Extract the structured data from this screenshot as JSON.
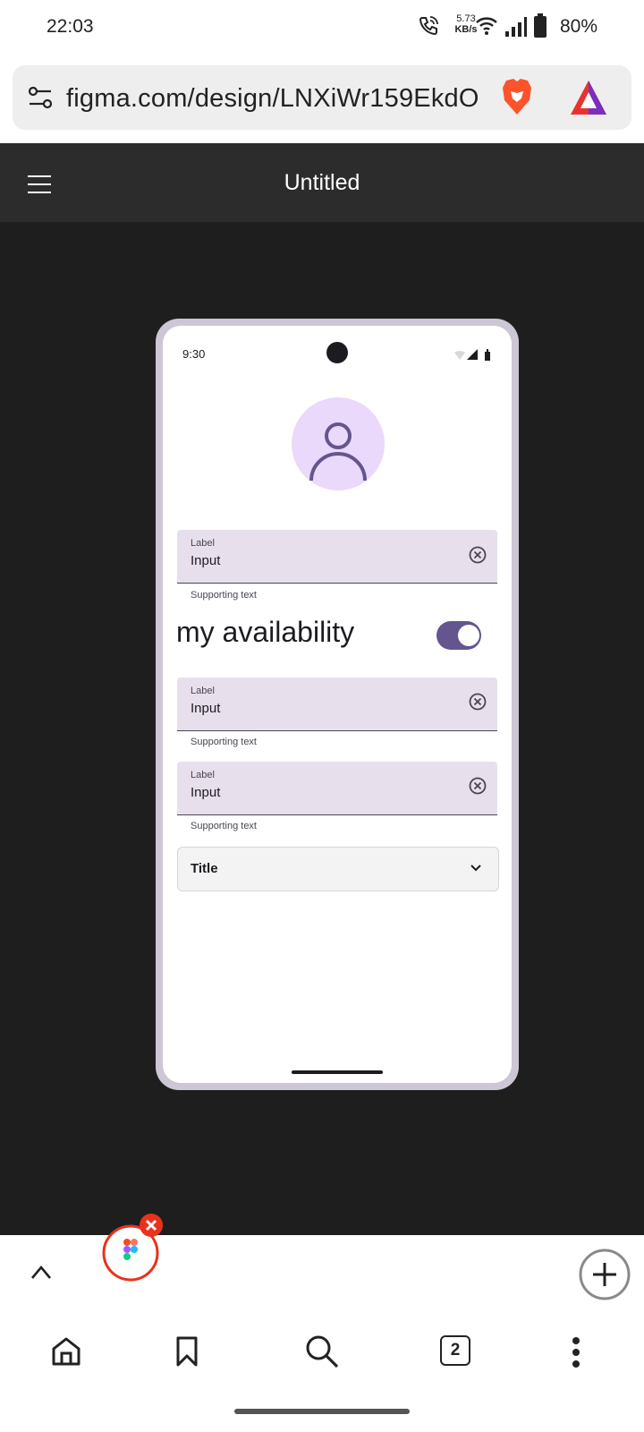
{
  "status_bar": {
    "time": "22:03",
    "net_speed_value": "5.73",
    "net_speed_unit": "KB/s",
    "battery": "80%"
  },
  "browser": {
    "url": "figma.com/design/LNXiWr159EkdO",
    "tab_count": "2"
  },
  "figma": {
    "file_title": "Untitled"
  },
  "mockup": {
    "status_time": "9:30",
    "fields": [
      {
        "label": "Label",
        "input": "Input",
        "supporting": "Supporting text"
      },
      {
        "label": "Label",
        "input": "Input",
        "supporting": "Supporting text"
      },
      {
        "label": "Label",
        "input": "Input",
        "supporting": "Supporting text"
      }
    ],
    "availability_label": "my availability",
    "availability_on": true,
    "dropdown_title": "Title"
  },
  "colors": {
    "accent": "#65558f",
    "field_bg": "#e7e0ec",
    "avatar_bg": "#ead9fb",
    "canvas_bg": "#1e1e1e",
    "header_bg": "#2c2c2c"
  }
}
